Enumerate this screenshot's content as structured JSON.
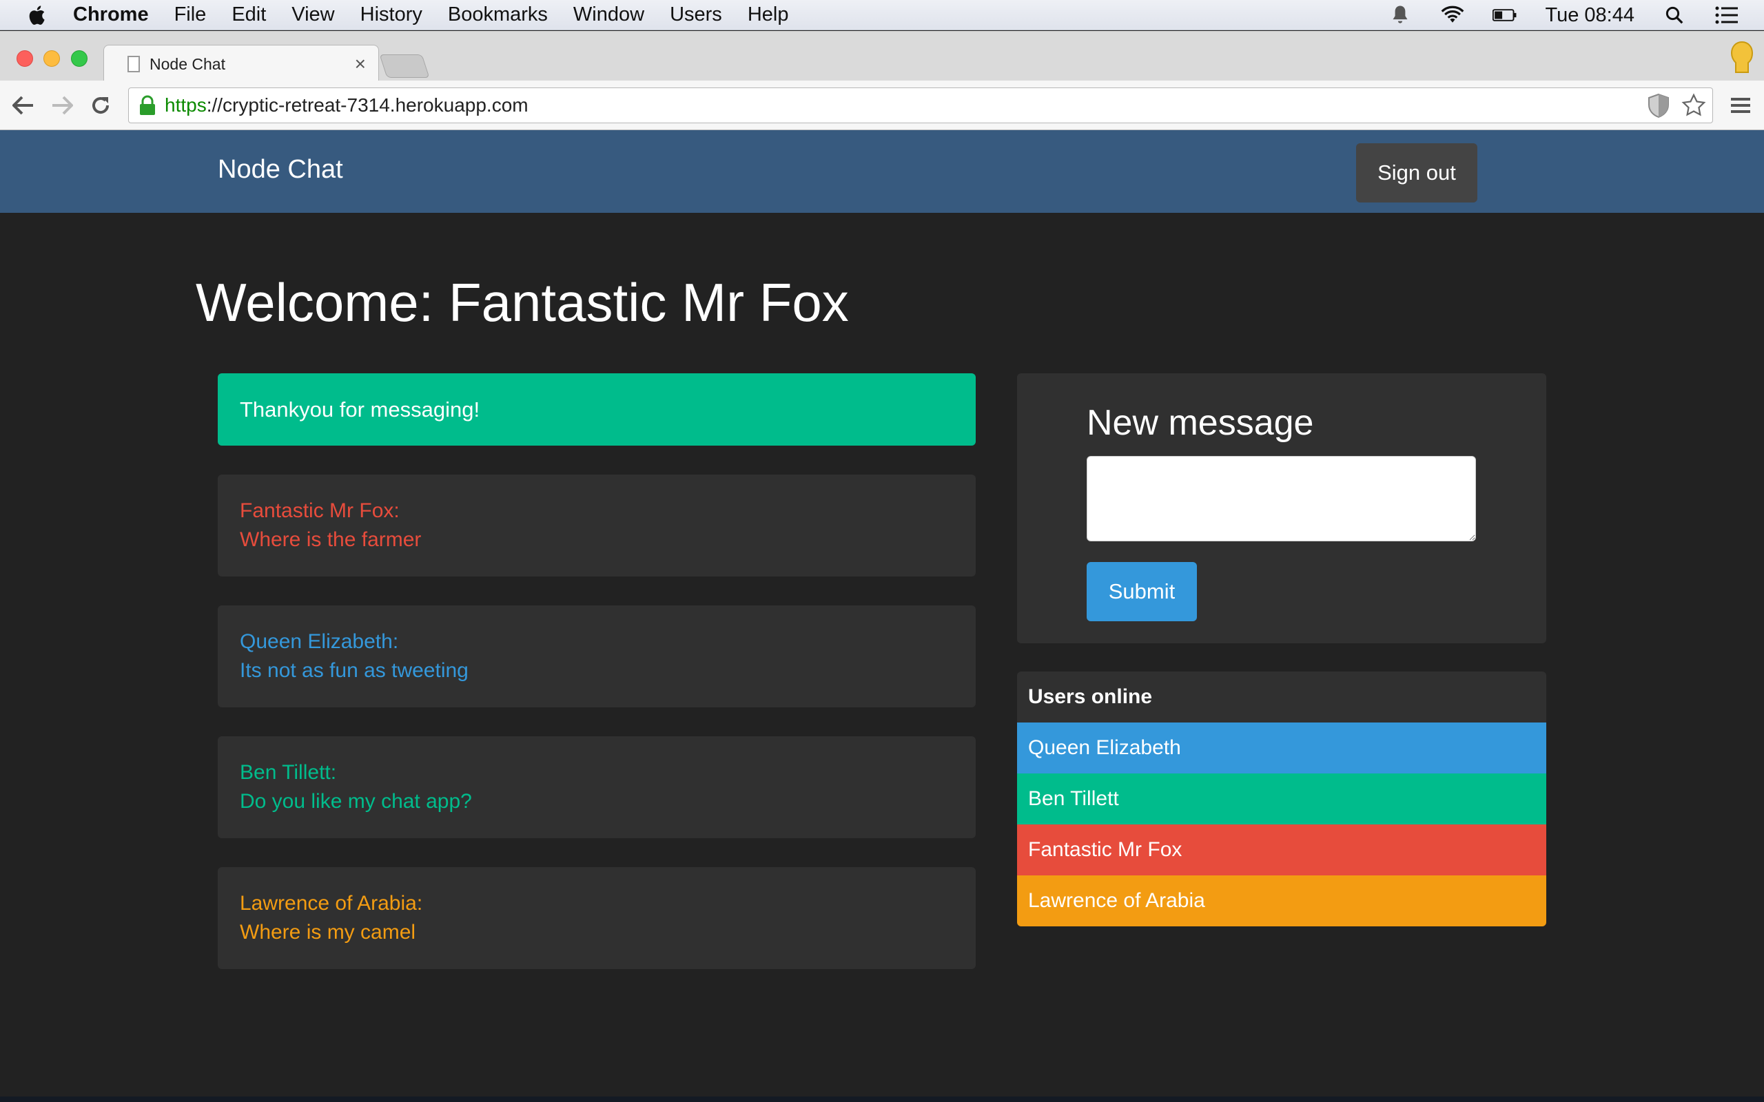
{
  "menubar": {
    "items": [
      "Chrome",
      "File",
      "Edit",
      "View",
      "History",
      "Bookmarks",
      "Window",
      "Users",
      "Help"
    ],
    "clock": "Tue 08:44",
    "icons": [
      "apple-icon",
      "notification-bell-icon",
      "wifi-icon",
      "battery-icon",
      "spotlight-search-icon",
      "notification-center-icon"
    ]
  },
  "browser": {
    "tab_title": "Node Chat",
    "tab_close": "×",
    "url_scheme": "https",
    "url_rest": "://cryptic-retreat-7314.herokuapp.com"
  },
  "app": {
    "brand": "Node Chat",
    "signout_label": "Sign out",
    "welcome": "Welcome: Fantastic Mr Fox",
    "alert": "Thankyou for messaging!",
    "messages": [
      {
        "author": "Fantastic Mr Fox:",
        "text": "Where is the farmer",
        "color": "#e74c3c"
      },
      {
        "author": "Queen Elizabeth:",
        "text": "Its not as fun as tweeting",
        "color": "#3498db"
      },
      {
        "author": "Ben Tillett:",
        "text": "Do you like my chat app?",
        "color": "#00bc8c"
      },
      {
        "author": "Lawrence of Arabia:",
        "text": "Where is my camel",
        "color": "#f39c12"
      }
    ],
    "new_message": {
      "title": "New message",
      "value": "",
      "submit_label": "Submit"
    },
    "users_online": {
      "title": "Users online",
      "users": [
        {
          "name": "Queen Elizabeth",
          "color": "#3498db"
        },
        {
          "name": "Ben Tillett",
          "color": "#00bc8c"
        },
        {
          "name": "Fantastic Mr Fox",
          "color": "#e74c3c"
        },
        {
          "name": "Lawrence of Arabia",
          "color": "#f39c12"
        }
      ]
    }
  },
  "colors": {
    "navbar": "#375a7f",
    "page_bg": "#222222",
    "panel_bg": "#303030",
    "success": "#00bc8c",
    "primary": "#3498db"
  }
}
